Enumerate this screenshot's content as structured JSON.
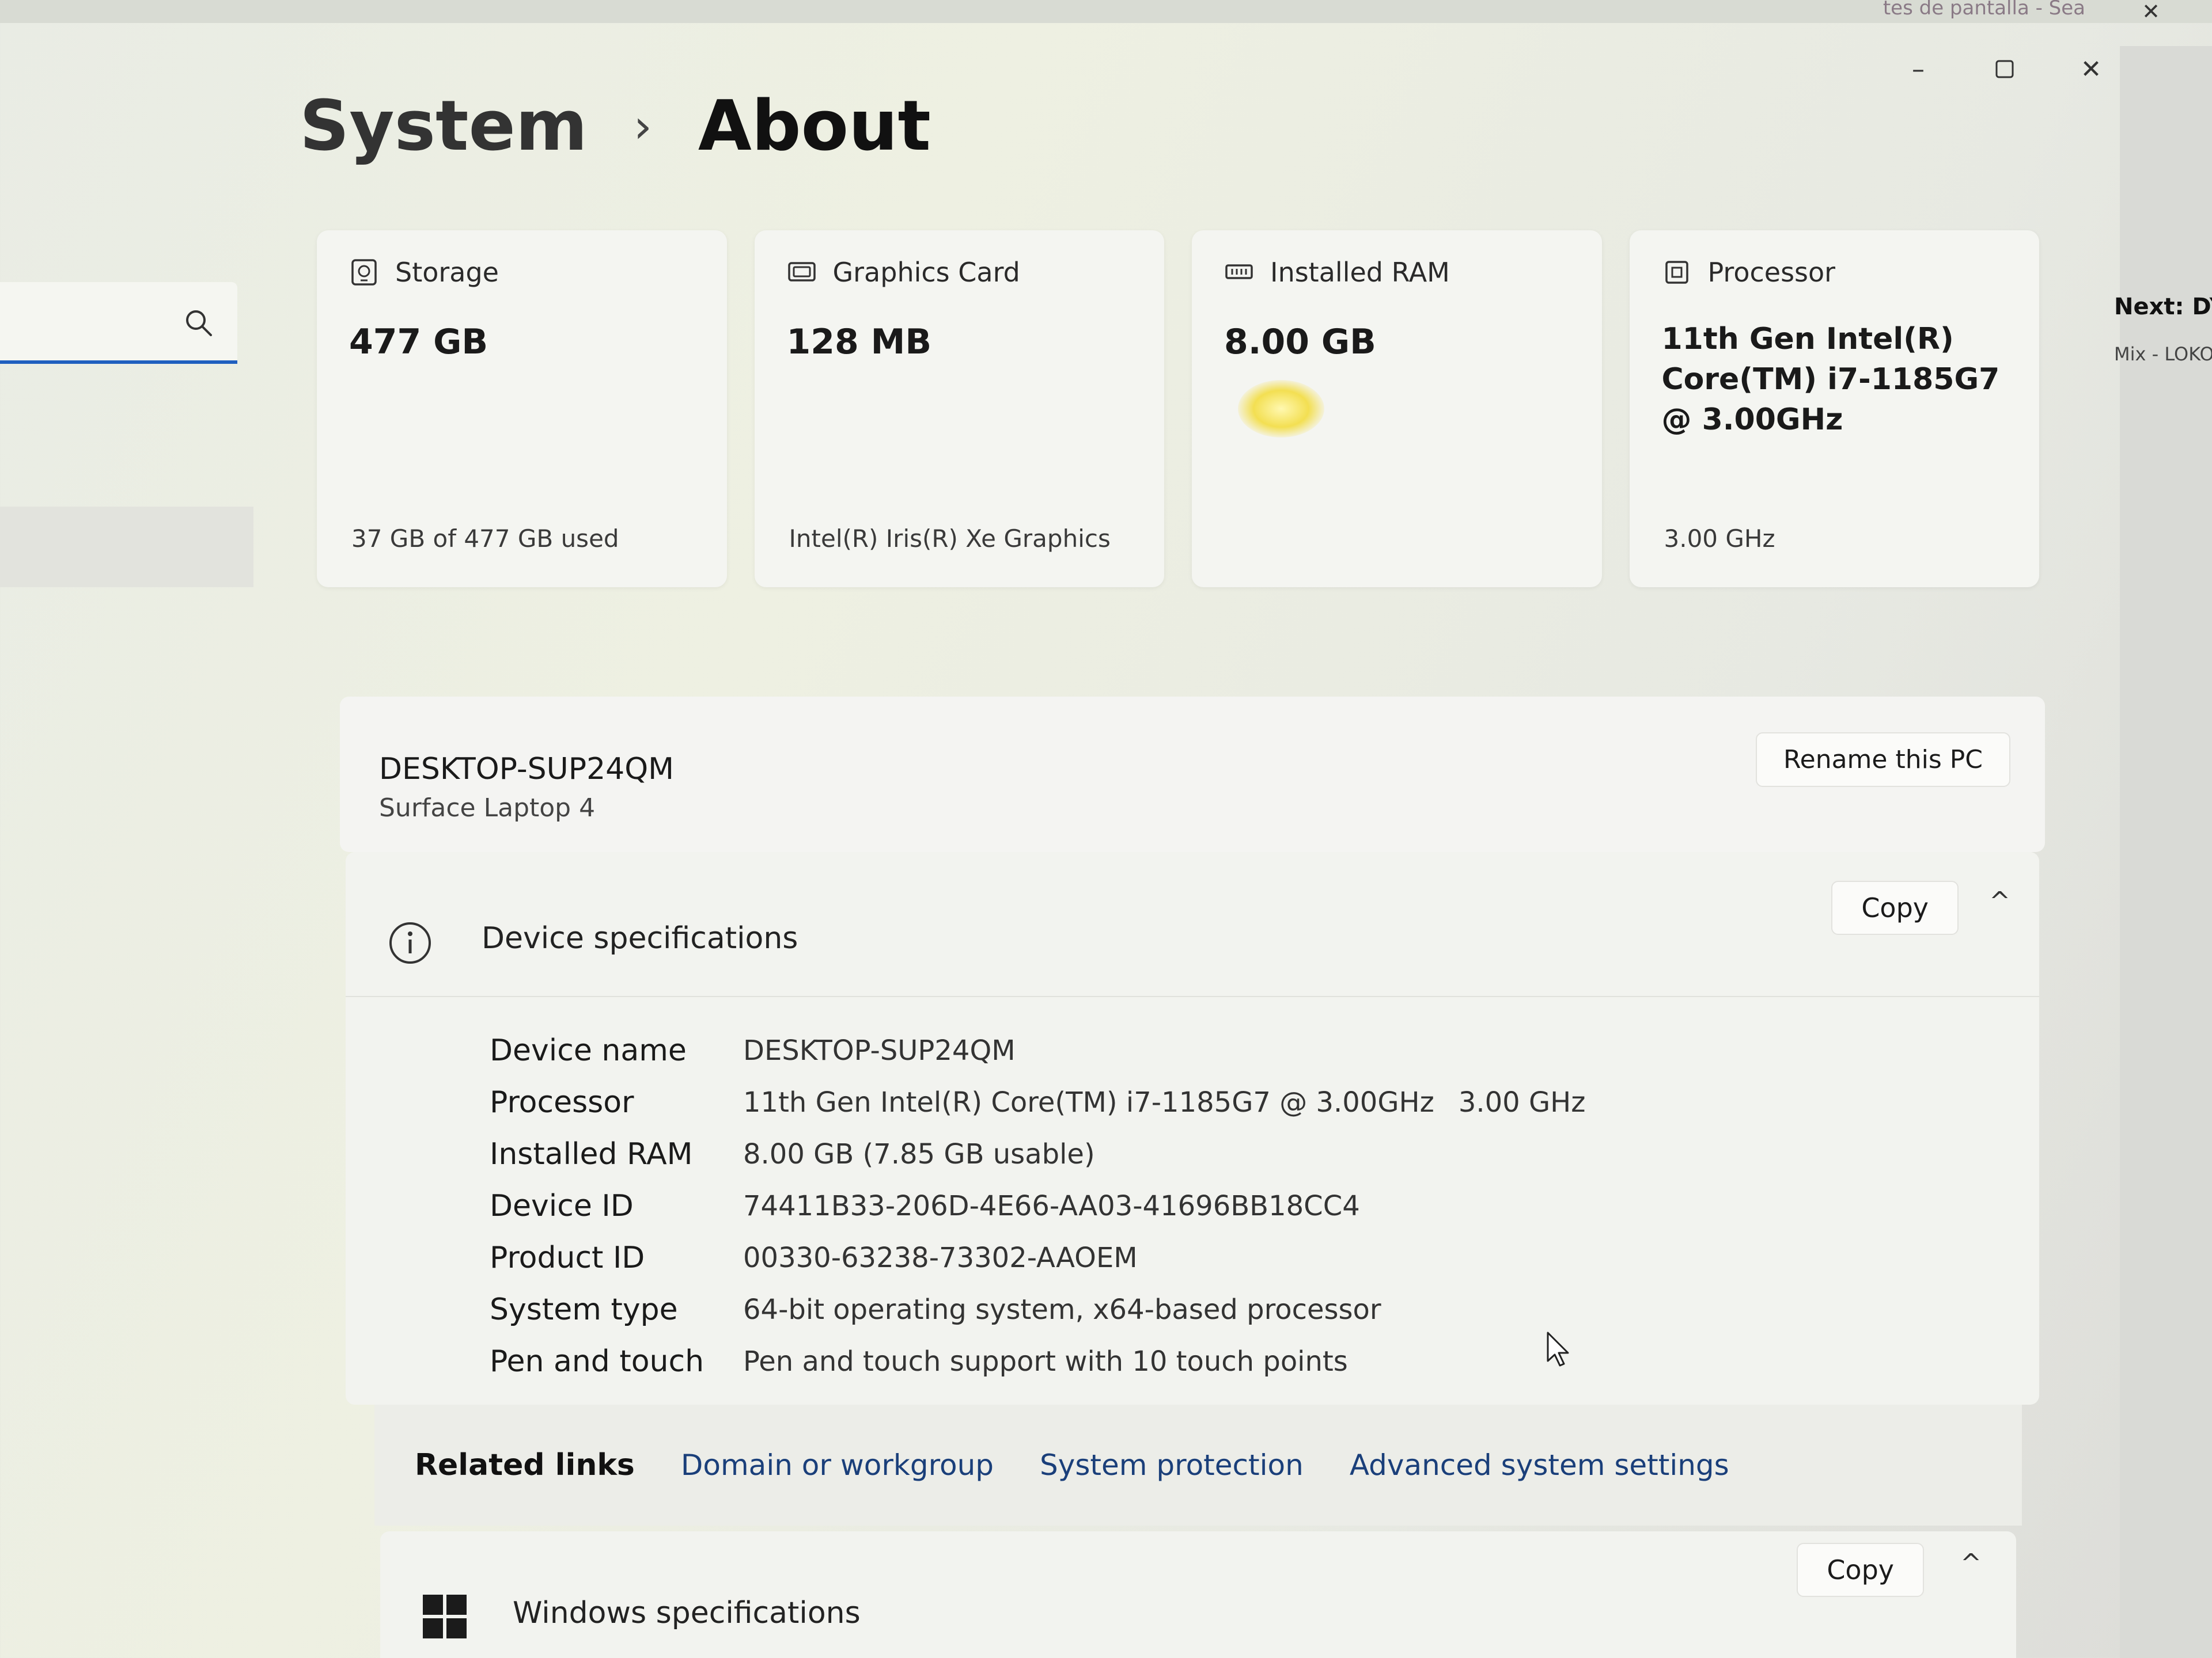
{
  "background": {
    "tab_title": "tes de pantalla - Sea",
    "next_label": "Next: DYF",
    "mix_label": "Mix - LOKO"
  },
  "breadcrumb": {
    "parent": "System",
    "separator": "›",
    "current": "About"
  },
  "tiles": [
    {
      "icon": "storage-icon",
      "title": "Storage",
      "value": "477 GB",
      "sub": "37 GB of 477 GB used"
    },
    {
      "icon": "graphics-card-icon",
      "title": "Graphics Card",
      "value": "128 MB",
      "sub": "Intel(R) Iris(R) Xe Graphics"
    },
    {
      "icon": "ram-icon",
      "title": "Installed RAM",
      "value": "8.00 GB",
      "sub": ""
    },
    {
      "icon": "processor-icon",
      "title": "Processor",
      "value": "11th Gen Intel(R) Core(TM) i7-1185G7 @ 3.00GHz",
      "sub": "3.00 GHz"
    }
  ],
  "device": {
    "name": "DESKTOP-SUP24QM",
    "model": "Surface Laptop 4",
    "rename_label": "Rename this PC"
  },
  "device_specs": {
    "title": "Device specifications",
    "copy_label": "Copy",
    "rows": [
      {
        "label": "Device name",
        "value": "DESKTOP-SUP24QM",
        "extra": ""
      },
      {
        "label": "Processor",
        "value": "11th Gen Intel(R) Core(TM) i7-1185G7 @ 3.00GHz",
        "extra": "3.00 GHz"
      },
      {
        "label": "Installed RAM",
        "value": "8.00 GB (7.85 GB usable)",
        "extra": ""
      },
      {
        "label": "Device ID",
        "value": "74411B33-206D-4E66-AA03-41696BB18CC4",
        "extra": ""
      },
      {
        "label": "Product ID",
        "value": "00330-63238-73302-AAOEM",
        "extra": ""
      },
      {
        "label": "System type",
        "value": "64-bit operating system, x64-based processor",
        "extra": ""
      },
      {
        "label": "Pen and touch",
        "value": "Pen and touch support with 10 touch points",
        "extra": ""
      }
    ]
  },
  "related_links": {
    "title": "Related links",
    "links": [
      "Domain or workgroup",
      "System protection",
      "Advanced system settings"
    ]
  },
  "windows_specs": {
    "title": "Windows specifications",
    "copy_label": "Copy"
  },
  "colors": {
    "accent": "#1f5fbf",
    "link": "#1a3f7a"
  }
}
